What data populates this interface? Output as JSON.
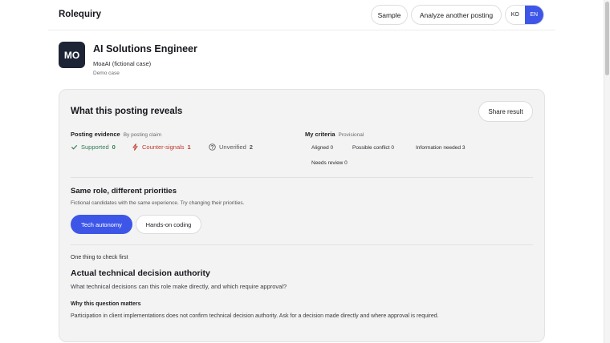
{
  "header": {
    "brand": "Rolequiry",
    "sample_label": "Sample",
    "analyze_label": "Analyze another posting",
    "lang_ko": "KO",
    "lang_en": "EN",
    "active_lang": "EN"
  },
  "job": {
    "logo_text": "MO",
    "title": "AI Solutions Engineer",
    "company": "MoaAI (fictional case)",
    "tag": "Demo case"
  },
  "reveal": {
    "title": "What this posting reveals",
    "share_label": "Share result",
    "evidence": {
      "label": "Posting evidence",
      "sub": "By posting claim",
      "supported_label": "Supported",
      "supported_count": "0",
      "counter_label": "Counter-signals",
      "counter_count": "1",
      "unverified_label": "Unverified",
      "unverified_count": "2"
    },
    "criteria": {
      "label": "My criteria",
      "sub": "Provisional",
      "aligned": "Aligned 0",
      "conflict": "Possible conflict 0",
      "info_needed": "Information needed 3",
      "review": "Needs review 0"
    }
  },
  "priorities": {
    "title": "Same role, different priorities",
    "subtitle": "Fictional candidates with the same experience. Try changing their priorities.",
    "options": [
      "Tech autonomy",
      "Hands-on coding"
    ],
    "selected": "Tech autonomy"
  },
  "check": {
    "label": "One thing to check first",
    "title": "Actual technical decision authority",
    "question": "What technical decisions can this role make directly, and which require approval?",
    "why_label": "Why this question matters",
    "why_text": "Participation in client implementations does not confirm technical decision authority. Ask for a decision made directly and where approval is required."
  },
  "colors": {
    "accent": "#3e56e8",
    "supported": "#2f7a52",
    "counter": "#c0392b",
    "logo_bg": "#1d2435",
    "card_bg": "#f3f3f3"
  },
  "icons": {
    "supported": "check-icon",
    "counter": "lightning-icon",
    "unverified": "question-circle-icon"
  }
}
